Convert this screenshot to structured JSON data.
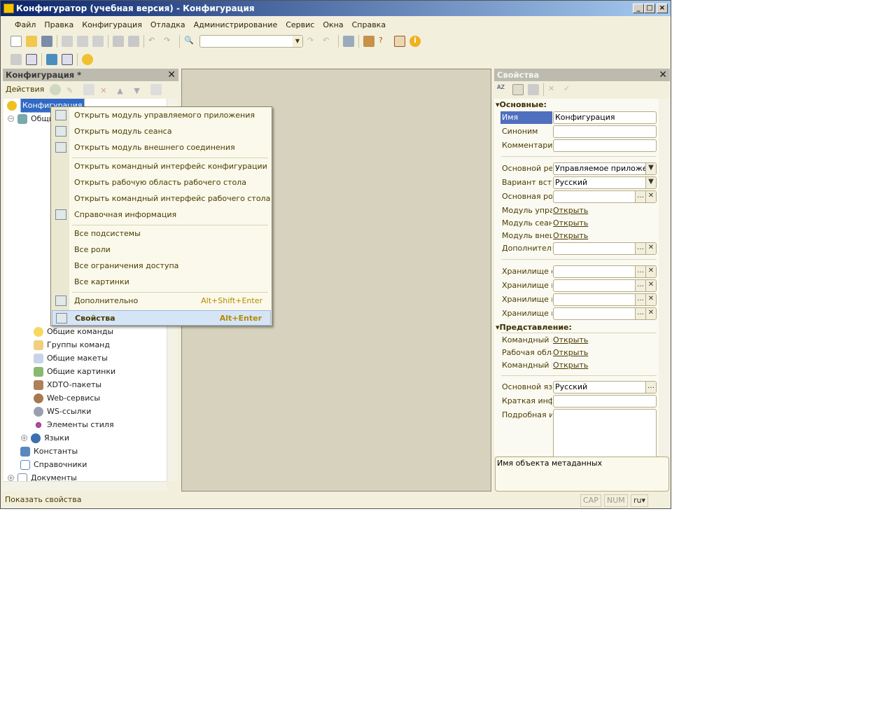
{
  "window": {
    "title": "Конфигуратор (учебная версия) - Конфигурация"
  },
  "menu": [
    "Файл",
    "Правка",
    "Конфигурация",
    "Отладка",
    "Администрирование",
    "Сервис",
    "Окна",
    "Справка"
  ],
  "left_panel": {
    "title": "Конфигурация *",
    "actions_label": "Действия",
    "tree": [
      {
        "label": "Конфигурация",
        "selected": true
      },
      {
        "label": "Общие"
      },
      {
        "label": "Общие команды"
      },
      {
        "label": "Группы команд"
      },
      {
        "label": "Общие макеты"
      },
      {
        "label": "Общие картинки"
      },
      {
        "label": "XDTO-пакеты"
      },
      {
        "label": "Web-сервисы"
      },
      {
        "label": "WS-ссылки"
      },
      {
        "label": "Элементы стиля"
      },
      {
        "label": "Языки"
      },
      {
        "label": "Константы"
      },
      {
        "label": "Справочники"
      },
      {
        "label": "Документы"
      }
    ]
  },
  "context_menu": [
    {
      "label": "Открыть модуль управляемого приложения"
    },
    {
      "label": "Открыть модуль сеанса"
    },
    {
      "label": "Открыть модуль внешнего соединения"
    },
    {
      "label": "Открыть командный интерфейс конфигурации"
    },
    {
      "label": "Открыть рабочую область рабочего стола"
    },
    {
      "label": "Открыть командный интерфейс рабочего стола"
    },
    {
      "label": "Справочная информация"
    },
    {
      "label": "Все подсистемы"
    },
    {
      "label": "Все роли"
    },
    {
      "label": "Все ограничения доступа"
    },
    {
      "label": "Все картинки"
    },
    {
      "label": "Дополнительно",
      "shortcut": "Alt+Shift+Enter"
    },
    {
      "label": "Свойства",
      "shortcut": "Alt+Enter"
    }
  ],
  "properties": {
    "title": "Свойства",
    "section_main": "Основные:",
    "section_view": "Представление:",
    "rows": [
      {
        "label": "Имя",
        "value": "Конфигурация"
      },
      {
        "label": "Синоним",
        "value": ""
      },
      {
        "label": "Комментарий",
        "value": ""
      },
      {
        "label": "Основной режим запуска",
        "value": "Управляемое приложение"
      },
      {
        "label": "Вариант встроенного языка",
        "value": "Русский"
      },
      {
        "label": "Основная роль",
        "value": ""
      },
      {
        "label": "Модуль управляемого приложения",
        "link": "Открыть"
      },
      {
        "label": "Модуль сеанса",
        "link": "Открыть"
      },
      {
        "label": "Модуль внешнего соединения",
        "link": "Открыть"
      },
      {
        "label": "Дополнительные",
        "value": ""
      },
      {
        "label": "Хранилище общих настроек",
        "value": ""
      },
      {
        "label": "Хранилище пользовательских настроек",
        "value": ""
      },
      {
        "label": "Хранилище вариантов отчетов",
        "value": ""
      },
      {
        "label": "Хранилище настроек",
        "value": ""
      },
      {
        "label": "Командный интерфейс",
        "link": "Открыть"
      },
      {
        "label": "Рабочая область",
        "link": "Открыть"
      },
      {
        "label": "Командный интерфейс",
        "link": "Открыть"
      },
      {
        "label": "Основной язык",
        "value": "Русский"
      },
      {
        "label": "Краткая информация",
        "value": ""
      },
      {
        "label": "Подробная информация",
        "value": ""
      }
    ],
    "description": "Имя объекта метаданных"
  },
  "status": {
    "text": "Показать свойства",
    "cap": "CAP",
    "num": "NUM",
    "lang": "ru"
  }
}
